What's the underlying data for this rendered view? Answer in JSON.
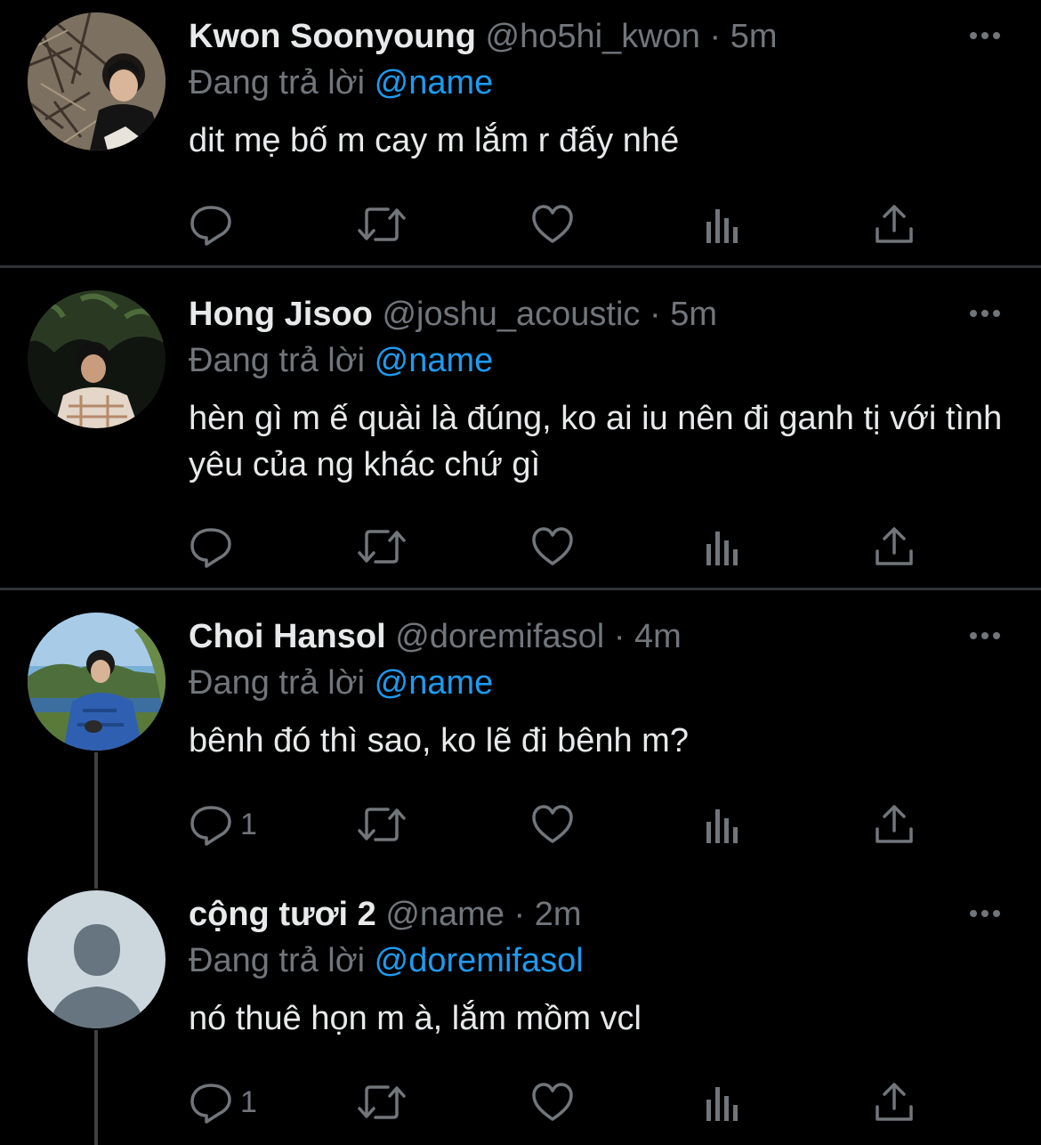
{
  "tweets": [
    {
      "display_name": "Kwon Soonyoung",
      "handle": "@ho5hi_kwon",
      "separator": "·",
      "time": "5m",
      "reply_prefix": "Đang trả lời",
      "reply_to": "@name",
      "text": "dit mẹ bố m cay m lắm r đấy nhé",
      "reply_count": "",
      "avatar": "photo of man sitting among bare branches"
    },
    {
      "display_name": "Hong Jisoo",
      "handle": "@joshu_acoustic",
      "separator": "·",
      "time": "5m",
      "reply_prefix": "Đang trả lời",
      "reply_to": "@name",
      "text": "hèn gì m ế quài là đúng, ko ai iu nên đi ganh tị với tình yêu của ng khác chứ gì",
      "reply_count": "",
      "avatar": "photo of man in plaid shirt with trees at night"
    },
    {
      "display_name": "Choi Hansol",
      "handle": "@doremifasol",
      "separator": "·",
      "time": "4m",
      "reply_prefix": "Đang trả lời",
      "reply_to": "@name",
      "text": "bênh đó thì sao, ko lẽ đi bênh m?",
      "reply_count": "1",
      "avatar": "photo of man in denim jacket by a lake"
    },
    {
      "display_name": "cộng tươi 2",
      "handle": "@name",
      "separator": "·",
      "time": "2m",
      "reply_prefix": "Đang trả lời",
      "reply_to": "@doremifasol",
      "text": "nó thuê họn m à, lắm mồm vcl",
      "reply_count": "1",
      "avatar": "default-profile-icon"
    }
  ],
  "icons": {
    "more": "more-icon",
    "reply": "reply-icon",
    "retweet": "retweet-icon",
    "like": "like-icon",
    "views": "views-icon",
    "share": "share-icon"
  },
  "colors": {
    "background": "#000000",
    "text": "#e7e9ea",
    "muted": "#71767b",
    "link": "#1d9bf0",
    "divider": "#2f3336"
  }
}
